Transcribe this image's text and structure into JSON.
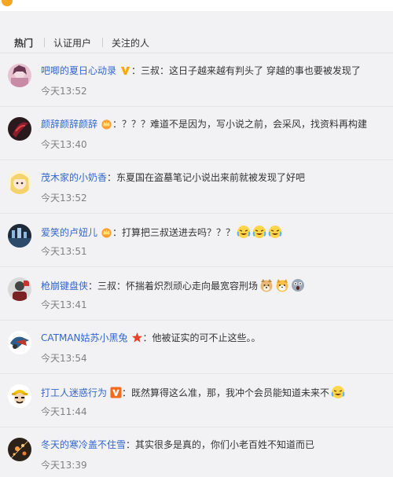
{
  "tabs": [
    {
      "label": "热门",
      "active": true
    },
    {
      "label": "认证用户",
      "active": false
    },
    {
      "label": "关注的人",
      "active": false
    }
  ],
  "comments": [
    {
      "user": "吧唧的夏日心动录",
      "badge": "gold-v-icon",
      "text": "三叔：这日子越来越有判头了 穿越的事也要被发现了",
      "time": "今天13:52"
    },
    {
      "user": "颜辞颜辞颜辞",
      "badge": "crown-icon",
      "text": "？？？难道不是因为，写小说之前，会采风，找资料再构建",
      "time": "今天13:40"
    },
    {
      "user": "茂木家的小奶香",
      "badge": "",
      "text": "东夏国在盗墓笔记小说出来前就被发现了好吧",
      "time": "今天13:52"
    },
    {
      "user": "爱笑的卢妞儿",
      "badge": "crown-icon",
      "text": "打算把三叔送进去吗？？？",
      "emojis": [
        "laughing-crying-emoji",
        "laughing-crying-emoji",
        "laughing-crying-emoji"
      ],
      "time": "今天13:51"
    },
    {
      "user": "枪崩键盘侠",
      "badge": "",
      "text": "三叔：怀揣着炽烈顽心走向最宽容刑场",
      "emojis": [
        "doge-emoji",
        "shiba-emoji",
        "shocked-emoji"
      ],
      "time": "今天13:41"
    },
    {
      "user": "CATMAN姑苏小黑兔",
      "badge": "red-star-icon",
      "text": "他被证实的可不止这些。。",
      "time": "今天13:54"
    },
    {
      "user": "打工人迷惑行为",
      "badge": "orange-v-icon",
      "text": "既然算得这么准，那，我冲个会员能知道未来不",
      "emojis": [
        "laughing-crying-emoji"
      ],
      "time": "今天11:44"
    },
    {
      "user": "冬天的寒冷盖不住雪",
      "badge": "",
      "text": "其实很多是真的，你们小老百姓不知道而已",
      "time": "今天13:39"
    }
  ],
  "colors": {
    "username": "#eb7350",
    "username_blue": "#3366cc",
    "time": "#808080",
    "background": "#f2f2f5"
  }
}
